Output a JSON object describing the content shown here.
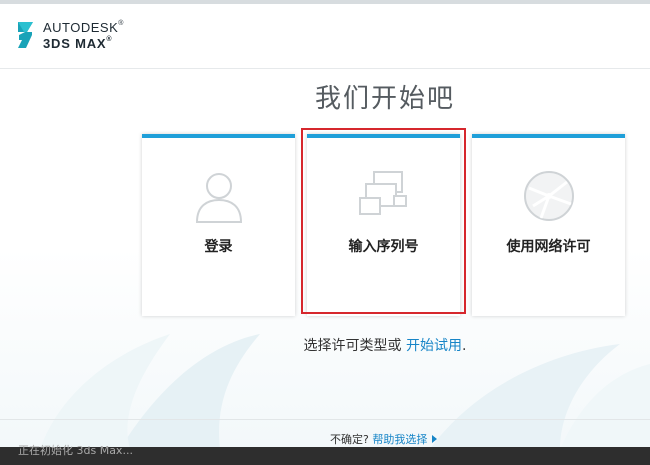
{
  "app": {
    "brand": "AUTODESK",
    "product": "3DS MAX",
    "trademark": "®"
  },
  "page": {
    "title": "我们开始吧"
  },
  "cards": [
    {
      "label": "登录",
      "icon": "user-silhouette-icon"
    },
    {
      "label": "输入序列号",
      "icon": "serial-screens-icon"
    },
    {
      "label": "使用网络许可",
      "icon": "network-globe-icon"
    }
  ],
  "license": {
    "prompt": "选择许可类型或",
    "trial_link": "开始试用",
    "period": "."
  },
  "help": {
    "prompt": "不确定?",
    "link": "帮助我选择",
    "arrow": "play-arrow-icon"
  },
  "status": {
    "text": "正在初始化 3ds Max..."
  },
  "colors": {
    "accent": "#1f9fd9",
    "link": "#1785c7",
    "highlight": "#d6272d",
    "status_bg": "#2e2e2e"
  }
}
